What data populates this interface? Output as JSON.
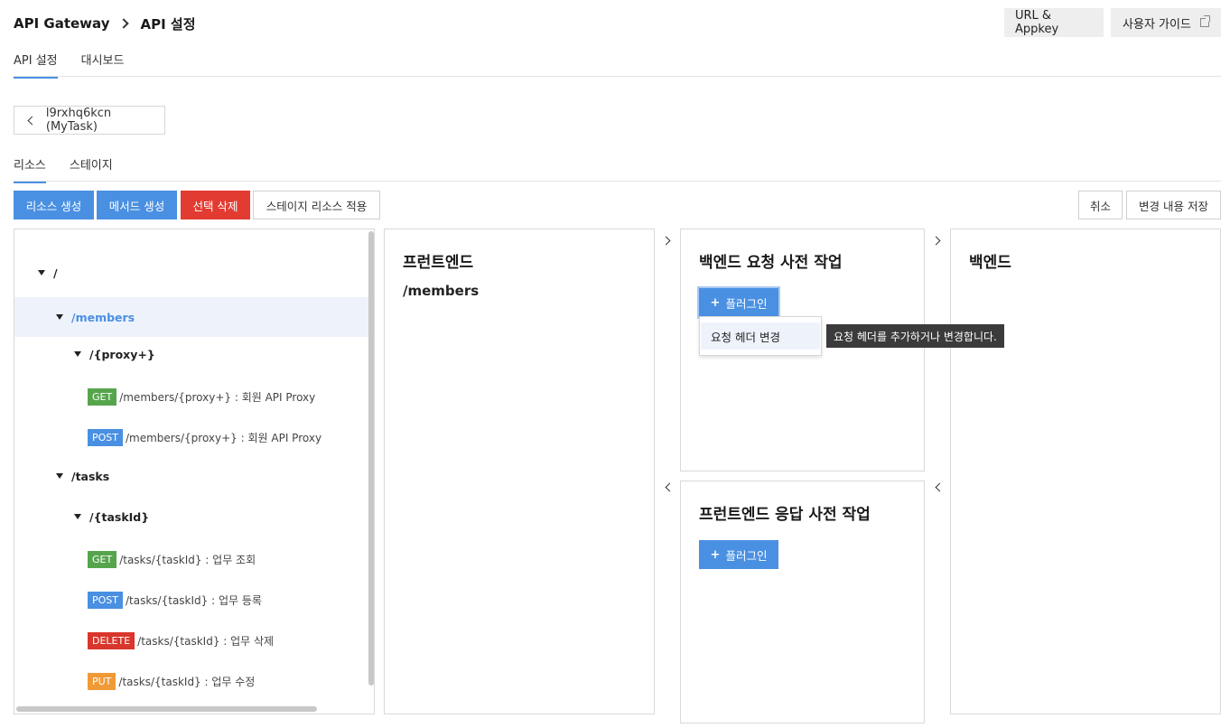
{
  "header": {
    "breadcrumb": [
      "API Gateway",
      "API 설정"
    ],
    "url_appkey_label": "URL & Appkey",
    "user_guide_label": "사용자 가이드"
  },
  "main_tabs": [
    {
      "label": "API 설정",
      "active": true
    },
    {
      "label": "대시보드",
      "active": false
    }
  ],
  "api_back_label": "l9rxhq6kcn (MyTask)",
  "sub_tabs": [
    {
      "label": "리소스",
      "active": true
    },
    {
      "label": "스테이지",
      "active": false
    }
  ],
  "toolbar": {
    "create_resource": "리소스 생성",
    "create_method": "메서드 생성",
    "delete_selected": "선택 삭제",
    "apply_stage": "스테이지 리소스 적용",
    "cancel": "취소",
    "save": "변경 내용 저장"
  },
  "tree": {
    "root": "/",
    "members": "/members",
    "members_proxy": "/{proxy+}",
    "members_methods": [
      {
        "method": "GET",
        "text": "/members/{proxy+} : 회원 API Proxy"
      },
      {
        "method": "POST",
        "text": "/members/{proxy+} : 회원 API Proxy"
      }
    ],
    "tasks": "/tasks",
    "tasks_id": "/{taskId}",
    "tasks_methods": [
      {
        "method": "GET",
        "text": "/tasks/{taskId} : 업무 조회"
      },
      {
        "method": "POST",
        "text": "/tasks/{taskId} : 업무 등록"
      },
      {
        "method": "DELETE",
        "text": "/tasks/{taskId} : 업무 삭제"
      },
      {
        "method": "PUT",
        "text": "/tasks/{taskId} : 업무 수정"
      }
    ]
  },
  "frontend": {
    "title": "프런트엔드",
    "path": "/members"
  },
  "backend_request": {
    "title": "백엔드 요청 사전 작업",
    "plugin_label": "플러그인"
  },
  "plugin_menu": {
    "item": "요청 헤더 변경",
    "tooltip": "요청 헤더를 추가하거나 변경합니다."
  },
  "frontend_response": {
    "title": "프런트엔드 응답 사전 작업",
    "plugin_label": "플러그인"
  },
  "backend": {
    "title": "백엔드"
  },
  "colors": {
    "accent": "#4a90e2",
    "danger": "#e23b32",
    "get": "#56a54d",
    "put": "#f09a37"
  }
}
